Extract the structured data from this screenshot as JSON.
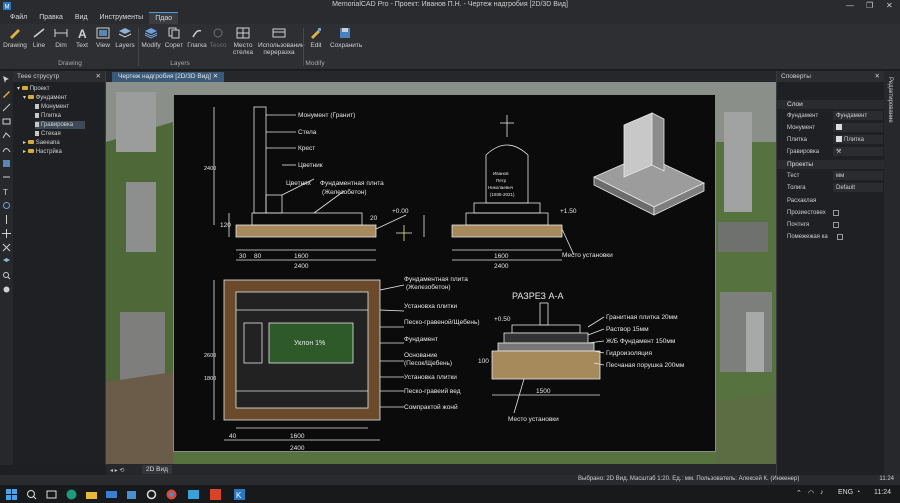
{
  "window": {
    "title": "MemorialCAD Pro - Проект: Иванов П.Н. - Чертеж надгробия [2D/3D Вид]",
    "controls": [
      "—",
      "❐",
      "✕"
    ]
  },
  "menu": [
    "Файл",
    "Правка",
    "Вид",
    "Инструменты",
    "Пдаo"
  ],
  "ribbon": {
    "buttons": {
      "drawing": "Drawing",
      "line": "Line",
      "dim": "Dim",
      "text": "Text",
      "view": "View",
      "layers": "Layers",
      "modify": "Modify",
      "copy": "Copeт",
      "glue": "Глагка",
      "tools": "Tesco",
      "place_line1": "Место",
      "place_line2": "стелка",
      "use_line1": "Использовании",
      "use_line2": "переразха",
      "edit": "Edit",
      "save": "Сохранить"
    },
    "groups": {
      "drawing": "Drawing",
      "layers": "Layers",
      "modify": "Modify"
    }
  },
  "tree": {
    "title": "Теее струсутр",
    "items": {
      "project": "Проект",
      "foundation": "Фундамент",
      "monument": "Монумент",
      "tile": "Плитка",
      "engraving": "Гравировка",
      "glass": "Стекая",
      "zaveana": "Saeeana",
      "settings": "Настрйка"
    }
  },
  "document": {
    "tab": "Чертеж надгробия [2D/3D Вид]",
    "bottom_tab": "2D Вид"
  },
  "drawing": {
    "labels": {
      "monument": "Монумент (Гранит)",
      "stele": "Стела",
      "cross": "Крест",
      "flower_bed": "Цветник",
      "flowers": "Цветнях",
      "foundation_slab": "Фундаментная плнта",
      "foundation_slab2": "(Железобетон)",
      "plus000": "+0.00",
      "plus150": "+1.50",
      "install_place": "Место установки",
      "name1": "Иванов",
      "name2": "Петр",
      "name3": "Николаевич",
      "dates": "(1935-2021)",
      "fslab_a": "Фундаментная плита",
      "fslab_b": "(Железобетон)",
      "tile_install": "Установха плитки",
      "sand_gravel": "Песко-гравеной/Щебень)",
      "foundation": "Фундамент",
      "base_a": "Основание",
      "base_b": "(Песок/Щебень)",
      "tile_install2": "Установка плитки",
      "sand_gravel2": "Песко-гравеий вед",
      "compacted": "Сомпрактой жонй",
      "slope": "Уклон 1%",
      "section": "РАЗРЕЗ А-А",
      "granite_tile": "Гранитная плитка 20мм",
      "mortar": "Раствор 15мм",
      "rc_foundation": "Ж/Б Фундамент 150мм",
      "waterproof": "Гидроизоляция",
      "sand_cushion": "Песчаная порушка 200мм",
      "install_place2": "Место установки",
      "plus050": "+0.50",
      "d2400": "2400",
      "d1600": "1600",
      "d80": "80",
      "d30": "30",
      "d40": "40",
      "d20": "20",
      "d120": "120",
      "d1500": "1500",
      "d2600": "2600",
      "d1800": "1800",
      "d100": "100"
    }
  },
  "properties": {
    "title": "Споверты",
    "section_layers": "Слои",
    "rows": {
      "foundation_k": "Фундамент",
      "foundation_v": "Фундамент",
      "monument_k": "Монумент",
      "tile_k": "Плитка",
      "tile_v": "Плитка",
      "engraving_k": "Гравировка",
      "projects": "Проекты",
      "text_k": "Тест",
      "text_v": "мм",
      "thickness_k": "Толига",
      "thickness_v": "Default",
      "expanded": "Расхаклая",
      "transparent": "Прозиестовех",
      "full": "Почтнгя",
      "pomezh": "Помежежая ка"
    },
    "side_tab": "Редактирование"
  },
  "status": {
    "text": "Выбрано: 2D Вид.  Масштаб 1:20.  Ед.: мм.  Пользователь: Алексей К. (Инженер)",
    "time": "11:24"
  },
  "taskbar": {
    "lang": "ENG",
    "time": "11:24"
  },
  "colors": {
    "accent": "#4a9edd",
    "drawing_bg": "#0b0b0c",
    "grass": "#4c6a3a"
  }
}
